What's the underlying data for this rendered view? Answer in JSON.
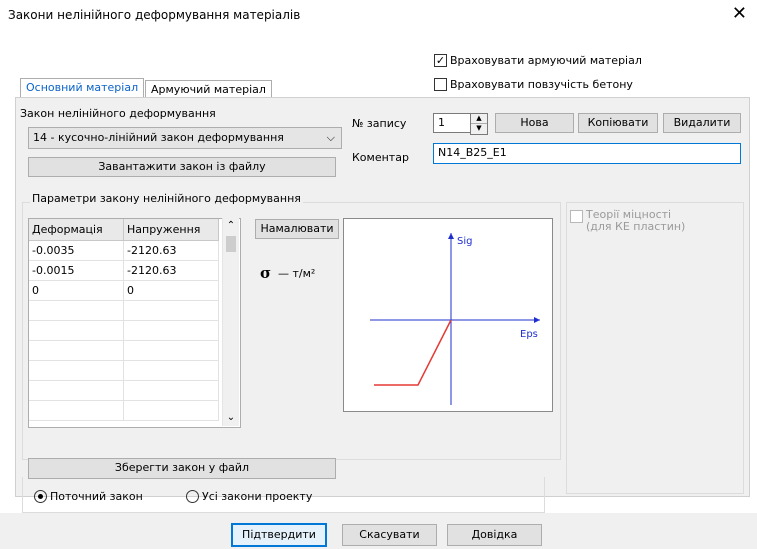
{
  "window": {
    "title": "Закони нелінійного деформування матеріалів"
  },
  "options": {
    "account_reinforcement": {
      "label": "Враховувати армуючий матеріал",
      "checked": true
    },
    "account_creep": {
      "label": "Враховувати повзучість бетону",
      "checked": false
    }
  },
  "tabs": [
    {
      "label": "Основний матеріал",
      "active": true
    },
    {
      "label": "Армуючий матеріал",
      "active": false
    }
  ],
  "law": {
    "label": "Закон нелінійного деформування",
    "selected": "14 - кусочно-лінійний закон деформування",
    "load_button": "Завантажити закон із файлу"
  },
  "record": {
    "label": "№ запису",
    "value": "1",
    "new_button": "Нова",
    "copy_button": "Копіювати",
    "delete_button": "Видалити",
    "comment_label": "Коментар",
    "comment_value": "N14_B25_E1"
  },
  "params": {
    "group_title": "Параметри закону нелінійного деформування",
    "columns": [
      "Деформація",
      "Напруження"
    ],
    "rows": [
      [
        "-0.0035",
        "-2120.63"
      ],
      [
        "-0.0015",
        "-2120.63"
      ],
      [
        "0",
        "0"
      ],
      [
        "",
        ""
      ],
      [
        "",
        ""
      ],
      [
        "",
        ""
      ],
      [
        "",
        ""
      ],
      [
        "",
        ""
      ],
      [
        "",
        ""
      ]
    ],
    "draw_button": "Намалювати",
    "sigma_symbol": "σ",
    "unit": "— т/м²",
    "chart_labels": {
      "y": "Sig",
      "x": "Eps"
    }
  },
  "chart_data": {
    "type": "line",
    "xlabel": "Eps",
    "ylabel": "Sig",
    "series": [
      {
        "color": "#e53935",
        "x": [
          -0.0035,
          -0.0015,
          0
        ],
        "y": [
          -2120.63,
          -2120.63,
          0
        ]
      }
    ],
    "grid": false
  },
  "strength": {
    "label": "Теорії міцності (для КЕ пластин)",
    "line1": "Теорії міцності",
    "line2": "(для КЕ пластин)",
    "enabled": false
  },
  "save_button": "Зберегти закон у файл",
  "scope": {
    "current": "Поточний закон",
    "project": "Усі закони проекту",
    "selected": "current"
  },
  "footer": {
    "ok": "Підтвердити",
    "cancel": "Скасувати",
    "help": "Довідка"
  },
  "colors": {
    "accent": "#0078d7",
    "tab_active": "#0a63c9",
    "curve": "#e53935",
    "axis": "#1f2fcf"
  }
}
